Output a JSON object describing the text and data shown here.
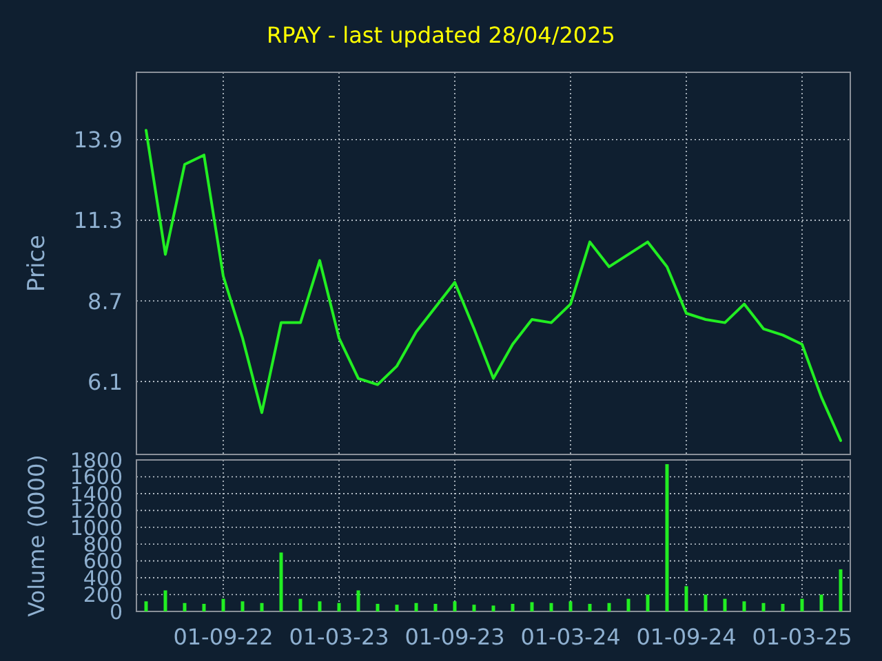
{
  "title": "RPAY - last updated 28/04/2025",
  "price_chart": {
    "chart_data": {
      "type": "line",
      "grid": true,
      "ylabel": "Price",
      "ylim": [
        3.75,
        16.07
      ],
      "yticks": [
        6.1,
        8.7,
        11.3,
        13.9
      ],
      "categories": [
        null,
        null,
        null,
        null,
        null,
        null,
        null,
        null,
        null,
        null,
        null,
        null,
        null,
        null,
        null,
        null,
        null,
        null,
        null,
        null,
        null,
        null,
        null,
        null,
        null,
        null,
        null,
        null,
        null,
        null,
        null,
        null,
        null,
        null,
        null,
        null,
        null
      ],
      "series": [
        {
          "color": "#22ee22",
          "values": [
            14.2,
            10.2,
            13.1,
            13.4,
            9.5,
            7.5,
            5.1,
            8.0,
            8.0,
            10.0,
            7.5,
            6.2,
            6.0,
            6.6,
            7.7,
            8.5,
            9.3,
            7.8,
            6.2,
            7.3,
            8.1,
            8.0,
            8.6,
            10.6,
            9.8,
            10.2,
            10.6,
            9.8,
            8.3,
            8.1,
            8.0,
            8.6,
            7.8,
            7.6,
            7.3,
            5.6,
            4.2
          ]
        }
      ]
    }
  },
  "volume_chart": {
    "chart_data": {
      "type": "bar",
      "grid": true,
      "ylabel": "Volume (0000)",
      "ylim": [
        0,
        1800
      ],
      "yticks": [
        0,
        200,
        400,
        600,
        800,
        1000,
        1200,
        1400,
        1600,
        1800
      ],
      "categories": [
        null,
        null,
        null,
        null,
        "01-09-22",
        null,
        null,
        null,
        null,
        null,
        "01-03-23",
        null,
        null,
        null,
        null,
        null,
        "01-09-23",
        null,
        null,
        null,
        null,
        null,
        "01-03-24",
        null,
        null,
        null,
        null,
        null,
        "01-09-24",
        null,
        null,
        null,
        null,
        null,
        "01-03-25",
        null,
        null
      ],
      "series": [
        {
          "color": "#22ee22",
          "values": [
            120,
            250,
            100,
            90,
            150,
            120,
            100,
            700,
            150,
            120,
            100,
            250,
            90,
            80,
            100,
            90,
            120,
            80,
            70,
            90,
            110,
            100,
            120,
            90,
            100,
            150,
            200,
            1750,
            300,
            200,
            150,
            120,
            100,
            90,
            150,
            200,
            500
          ]
        }
      ]
    }
  }
}
